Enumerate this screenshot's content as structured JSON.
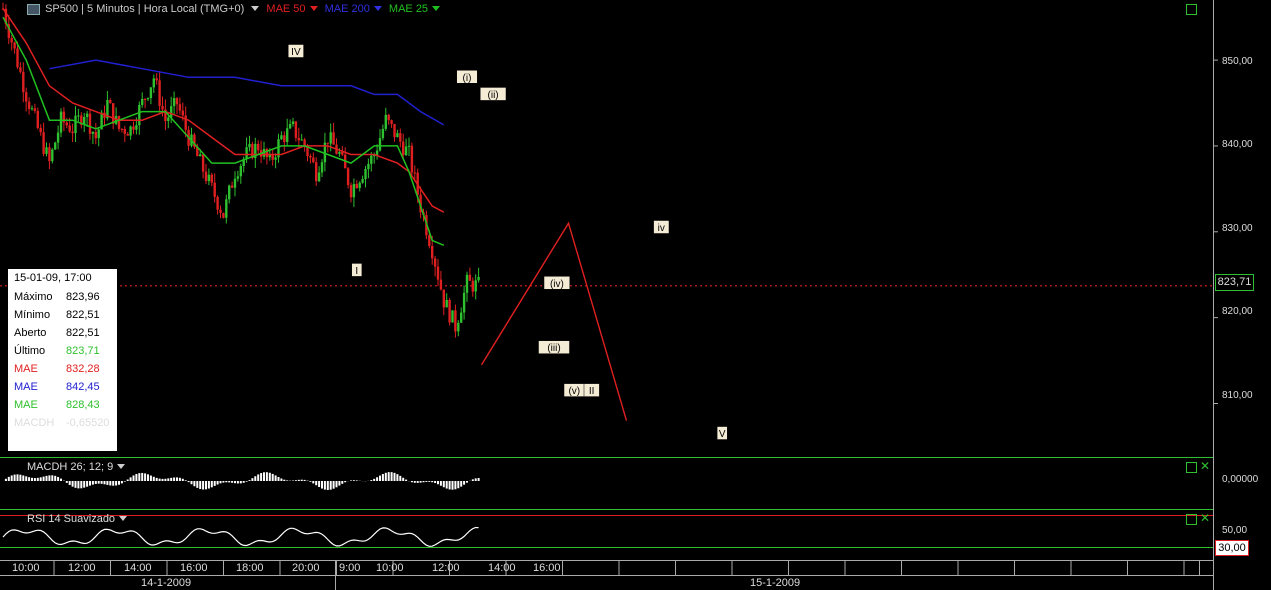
{
  "header": {
    "symbol_icon": "cfd-icon",
    "title": "SP500 | 5 Minutos | Hora Local (TMG+0)",
    "mae50_label": "MAE 50",
    "mae200_label": "MAE 200",
    "mae25_label": "MAE 25"
  },
  "colors": {
    "background": "#000000",
    "up_candle": "#2ec02e",
    "down_candle": "#e02020",
    "mae50": "#e02020",
    "mae200": "#2020d0",
    "mae25": "#20c020",
    "last_price_line": "#e02020",
    "rsi_bands": "#e02020"
  },
  "price_panel": {
    "y_ticks": [
      "850,00",
      "840,00",
      "830,00",
      "820,00",
      "810,00"
    ],
    "last_price": "823,71"
  },
  "info_box": {
    "date": "15-01-09, 17:00",
    "rows": [
      {
        "label": "Máximo",
        "value": "823,96",
        "color": "#000000"
      },
      {
        "label": "Mínimo",
        "value": "822,51",
        "color": "#000000"
      },
      {
        "label": "Aberto",
        "value": "822,51",
        "color": "#000000"
      },
      {
        "label": "Último",
        "value": "823,71",
        "color": "#2ec02e"
      },
      {
        "label": "MAE",
        "value": "832,28",
        "color": "#e02020"
      },
      {
        "label": "MAE",
        "value": "842,45",
        "color": "#2020d0"
      },
      {
        "label": "MAE",
        "value": "828,43",
        "color": "#2ec02e"
      }
    ],
    "macdh_label": "MACDH",
    "macdh_value": "-0,65520"
  },
  "macdh_panel": {
    "label": "MACDH 26; 12; 9",
    "y_tick": "0,00000"
  },
  "rsi_panel": {
    "label": "RSI 14 Suavizado",
    "y_tick": "50,00",
    "level_label": "30,00"
  },
  "time_axis": {
    "ticks": [
      "10:00",
      "12:00",
      "14:00",
      "16:00",
      "18:00",
      "20:00",
      "9:00",
      "10:00",
      "12:00",
      "14:00",
      "16:00"
    ],
    "dates": [
      "14-1-2009",
      "15-1-2009"
    ]
  },
  "chart_data": {
    "type": "line",
    "title": "SP500 | 5 Minutos | Hora Local (TMG+0)",
    "x_unit": "bar index (5-minute bars)",
    "ylim": [
      804,
      857
    ],
    "series": [
      {
        "name": "SP500",
        "x": [
          0,
          4,
          8,
          12,
          16,
          20,
          24,
          28,
          32,
          36,
          40,
          44,
          48,
          52,
          56,
          60,
          64,
          68,
          72,
          76,
          80,
          84,
          88,
          92,
          96,
          100,
          104,
          108,
          112,
          116,
          120,
          124,
          128,
          132,
          136,
          140,
          144,
          148,
          152,
          156,
          160,
          164,
          168,
          172,
          176,
          180,
          184,
          188,
          192
        ],
        "values": [
          856,
          851,
          846,
          842,
          838,
          843,
          842,
          844,
          841,
          845,
          842,
          842,
          845,
          848,
          843,
          845,
          841,
          838,
          835,
          832,
          837,
          839,
          840,
          838,
          841,
          842,
          840,
          837,
          841,
          839,
          835,
          837,
          839,
          843,
          841,
          839,
          833,
          828,
          822,
          819,
          824,
          823.71,
          null,
          null,
          null,
          null,
          null,
          null,
          null
        ]
      },
      {
        "name": "MAE 50",
        "x": [
          0,
          8,
          16,
          24,
          32,
          40,
          48,
          56,
          64,
          72,
          80,
          88,
          96,
          104,
          112,
          120,
          128,
          136,
          140,
          144,
          148,
          152
        ],
        "values": [
          856,
          852,
          847,
          845,
          844,
          843,
          843,
          844,
          843,
          841,
          839,
          839,
          839,
          840,
          840,
          839,
          839,
          838,
          837,
          835,
          833,
          832.28
        ]
      },
      {
        "name": "MAE 200",
        "x": [
          16,
          32,
          48,
          64,
          80,
          96,
          112,
          120,
          128,
          136,
          144,
          152
        ],
        "values": [
          849,
          850,
          849,
          848,
          848,
          847,
          847,
          847,
          846,
          846,
          844,
          842.45
        ]
      },
      {
        "name": "MAE 25",
        "x": [
          0,
          8,
          16,
          24,
          32,
          40,
          48,
          56,
          64,
          72,
          80,
          88,
          96,
          104,
          112,
          120,
          128,
          136,
          140,
          144,
          148,
          152
        ],
        "values": [
          855,
          850,
          843,
          843,
          842,
          843,
          844,
          844,
          841,
          838,
          838,
          839,
          840,
          840,
          839,
          838,
          840,
          840,
          837,
          833,
          829,
          828.43
        ]
      }
    ],
    "wave_labels": [
      "IV",
      "I",
      "(i)",
      "(ii)",
      "(iv)",
      "(iii)",
      "(v)",
      "II",
      "iv",
      "V"
    ],
    "projection": [
      [
        165,
        814.5
      ],
      [
        195,
        831
      ],
      [
        215,
        808
      ]
    ]
  }
}
